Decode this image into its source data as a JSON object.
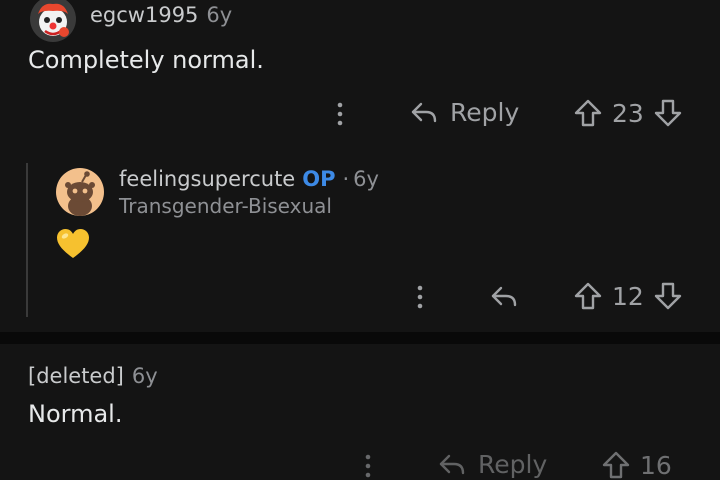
{
  "comments": [
    {
      "author": "egcw1995",
      "time": "6y",
      "body": "Completely normal.",
      "reply_label": "Reply",
      "score": "23"
    },
    {
      "author": "feelingsupercute",
      "op_badge": "OP",
      "separator": "·",
      "time": "6y",
      "flair": "Transgender-Bisexual",
      "body_emoji": "💛",
      "score": "12"
    },
    {
      "author": "[deleted]",
      "time": "6y",
      "body": "Normal.",
      "reply_label": "Reply",
      "score": "16"
    }
  ],
  "colors": {
    "background": "#141414",
    "op_badge": "#3d8ae6",
    "muted": "#8e9094",
    "heart": "#f6c12f"
  },
  "icons": [
    "avatar-clown",
    "avatar-snoo",
    "more-vertical-icon",
    "reply-icon",
    "upvote-icon",
    "downvote-icon"
  ]
}
